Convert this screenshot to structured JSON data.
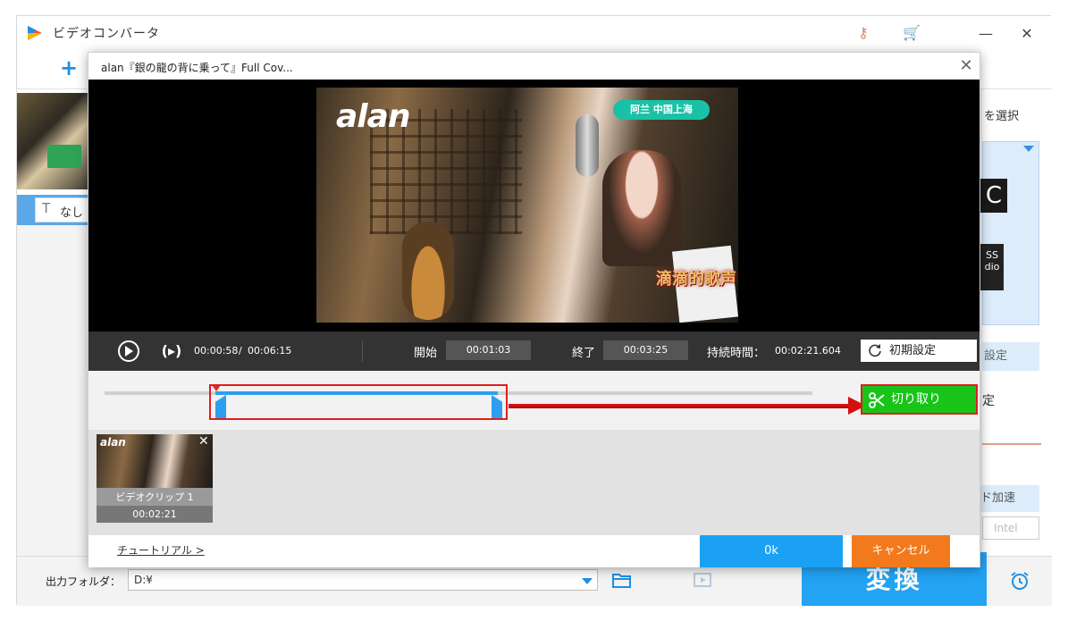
{
  "app": {
    "title": "ビデオコンバータ",
    "add_label": "+",
    "minimize_label": "—",
    "close_label": "✕",
    "icons": [
      "key-icon",
      "cart-icon",
      "minimize-icon",
      "close-icon"
    ]
  },
  "left_panel": {
    "subtitle_label": "なし"
  },
  "right_panel": {
    "format_select_label": "を選択",
    "format_code_top": "C",
    "format_code_bottom": "SS\ndio",
    "param_settings_label": "設定",
    "setting_label": "定",
    "hw_accel_label": "ド加速",
    "intel_label": "Intel"
  },
  "footer": {
    "output_folder_label": "出力フォルダ：",
    "output_folder_value": "D:¥",
    "convert_label": "変換"
  },
  "dialog": {
    "title": "alan『銀の龍の背に乗って』Full Cov...",
    "close_label": "✕",
    "video_overlay": {
      "brand": "alan",
      "badge": "阿兰 中国上海",
      "logo": "滴滴的歌声"
    },
    "controls": {
      "current_time": "00:00:58",
      "separator": "/",
      "total_time": "00:06:15",
      "start_label": "開始",
      "start_value": "00:01:03",
      "end_label": "終了",
      "end_value": "00:03:25",
      "duration_label": "持続時間：",
      "duration_value": "00:02:21.604",
      "reset_label": "初期設定"
    },
    "timeline": {
      "range_start_fraction": 0.168,
      "range_end_fraction": 0.547,
      "cut_label": "切り取り"
    },
    "clips": [
      {
        "name": "ビデオクリップ 1",
        "duration": "00:02:21",
        "thumb_brand": "alan"
      }
    ],
    "tutorial_label": "チュートリアル >",
    "ok_label": "0k",
    "cancel_label": "キャンセル"
  },
  "colors": {
    "accent": "#1e8fe6",
    "cut_button": "#18c418",
    "cancel_button": "#f27a1c",
    "highlight_red": "#e01e1e"
  }
}
